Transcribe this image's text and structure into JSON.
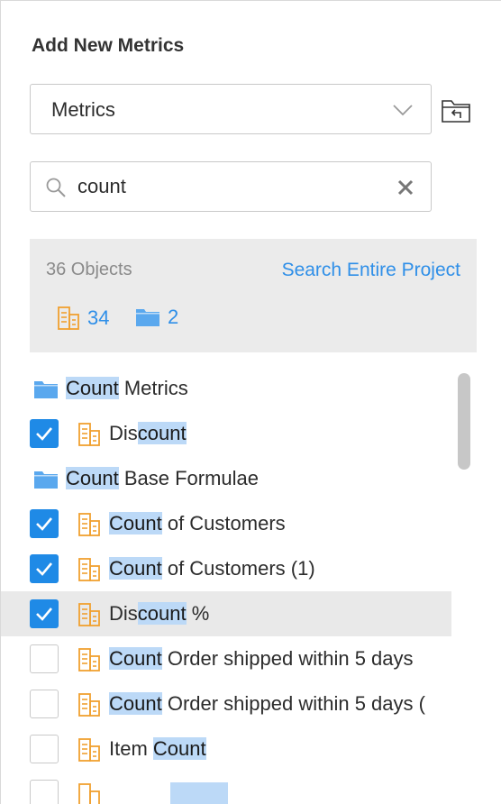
{
  "panel": {
    "title": "Add New Metrics"
  },
  "type_select": {
    "value": "Metrics"
  },
  "search": {
    "value": "count"
  },
  "summary": {
    "objects_label": "36 Objects",
    "search_link": "Search Entire Project",
    "metric_count": "34",
    "folder_count": "2"
  },
  "list": {
    "items": [
      {
        "type": "folder",
        "hl": "Count",
        "post": " Metrics"
      },
      {
        "type": "metric",
        "checked": true,
        "pre": "Dis",
        "hl": "count",
        "post": ""
      },
      {
        "type": "folder",
        "hl": "Count",
        "post": " Base Formulae"
      },
      {
        "type": "metric",
        "checked": true,
        "pre": "",
        "hl": "Count",
        "post": " of Customers"
      },
      {
        "type": "metric",
        "checked": true,
        "pre": "",
        "hl": "Count",
        "post": " of Customers (1)"
      },
      {
        "type": "metric",
        "checked": true,
        "highlighted_row": true,
        "pre": "Dis",
        "hl": "count",
        "post": " %"
      },
      {
        "type": "metric",
        "checked": false,
        "pre": "",
        "hl": "Count",
        "post": " Order shipped within 5 days"
      },
      {
        "type": "metric",
        "checked": false,
        "pre": "",
        "hl": "Count",
        "post": " Order shipped within 5 days ("
      },
      {
        "type": "metric",
        "checked": false,
        "pre": "Item ",
        "hl": "Count",
        "post": ""
      }
    ]
  },
  "colors": {
    "accent": "#1f8ae6",
    "link": "#2f8fe8",
    "metric_icon": "#f0a030",
    "folder_icon": "#5aa8ee",
    "search_highlight": "#bcd9f7",
    "summary_bg": "#ebebeb"
  },
  "icons": {
    "dropdown": "chevron-down-icon",
    "folder_action": "folder-return-icon",
    "search": "search-icon",
    "clear": "close-icon",
    "metric": "metric-icon",
    "folder": "folder-icon",
    "check": "checkmark-icon"
  }
}
